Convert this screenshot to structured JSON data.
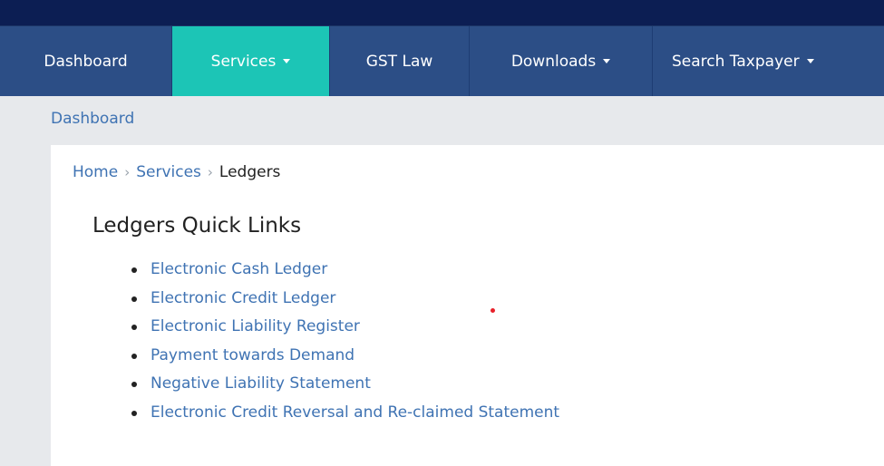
{
  "nav": {
    "items": [
      {
        "label": "Dashboard",
        "dropdown": false,
        "active": false
      },
      {
        "label": "Services",
        "dropdown": true,
        "active": true
      },
      {
        "label": "GST Law",
        "dropdown": false,
        "active": false
      },
      {
        "label": "Downloads",
        "dropdown": true,
        "active": false
      },
      {
        "label": "Search Taxpayer",
        "dropdown": true,
        "active": false
      }
    ]
  },
  "subbar": {
    "dashboard_link": "Dashboard"
  },
  "breadcrumb": {
    "home": "Home",
    "services": "Services",
    "current": "Ledgers"
  },
  "main": {
    "title": "Ledgers Quick Links",
    "links": [
      "Electronic Cash Ledger",
      "Electronic Credit Ledger",
      "Electronic Liability Register",
      "Payment towards Demand",
      "Negative Liability Statement",
      "Electronic Credit Reversal and Re-claimed Statement"
    ]
  },
  "colors": {
    "topbar": "#0c1e53",
    "nav_bg": "#2c4e86",
    "nav_active": "#1cc5b6",
    "link": "#3f73b3",
    "cursor_dot": "#e8202a"
  }
}
